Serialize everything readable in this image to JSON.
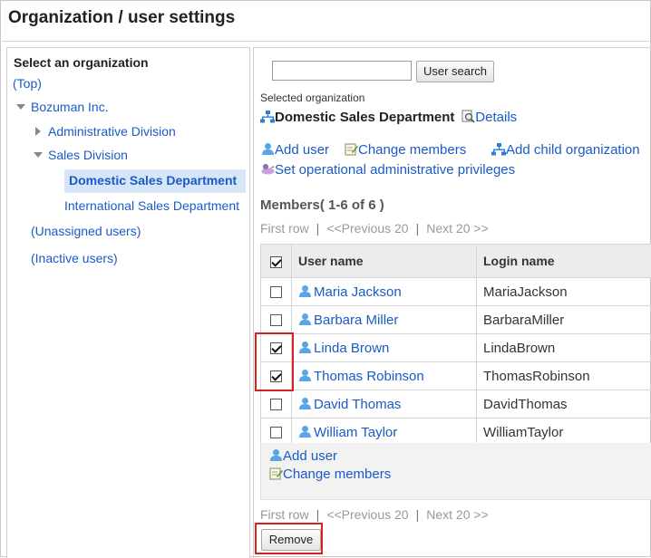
{
  "page": {
    "title": "Organization / user settings"
  },
  "left": {
    "heading": "Select an organization",
    "tree": {
      "top": "(Top)",
      "root": "Bozuman Inc.",
      "admin": "Administrative Division",
      "sales": "Sales Division",
      "domestic": "Domestic Sales Department",
      "international": "International Sales Department",
      "unassigned": "(Unassigned users)",
      "inactive": "(Inactive users)"
    }
  },
  "search": {
    "value": "",
    "button": "User search"
  },
  "selected": {
    "label": "Selected organization",
    "name": "Domestic Sales Department",
    "details": "Details"
  },
  "actions": {
    "add_user": "Add user",
    "change_members": "Change members",
    "add_child": "Add child organization",
    "privileges": "Set operational administrative privileges"
  },
  "members": {
    "title": "Members( 1-6 of 6 )",
    "pager": {
      "first": "First row",
      "prev": "<<Previous 20",
      "next": "Next 20 >>"
    },
    "columns": [
      "User name",
      "Login name"
    ],
    "rows": [
      {
        "name": "Maria Jackson",
        "login": "MariaJackson",
        "checked": false
      },
      {
        "name": "Barbara Miller",
        "login": "BarbaraMiller",
        "checked": false
      },
      {
        "name": "Linda Brown",
        "login": "LindaBrown",
        "checked": true
      },
      {
        "name": "Thomas Robinson",
        "login": "ThomasRobinson",
        "checked": true
      },
      {
        "name": "David Thomas",
        "login": "DavidThomas",
        "checked": false
      },
      {
        "name": "William Taylor",
        "login": "WilliamTaylor",
        "checked": false
      }
    ],
    "footer": {
      "add_user": "Add user",
      "change_members": "Change members"
    }
  },
  "remove_button": "Remove",
  "colors": {
    "link": "#1a5ac8",
    "highlight": "#d42222",
    "selected_bg": "#d6e6f7"
  }
}
